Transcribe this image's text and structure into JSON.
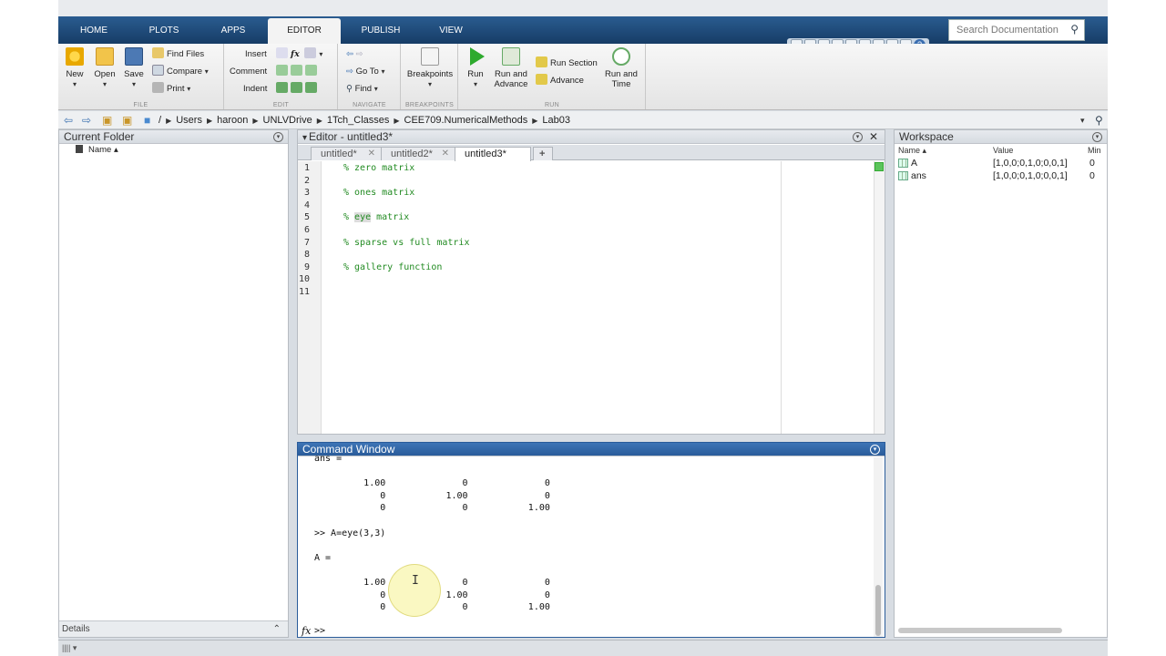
{
  "tabs": [
    "HOME",
    "PLOTS",
    "APPS",
    "EDITOR",
    "PUBLISH",
    "VIEW"
  ],
  "active_tab": "EDITOR",
  "search": {
    "placeholder": "Search Documentation"
  },
  "ribbon": {
    "file": {
      "new": "New",
      "open": "Open",
      "save": "Save",
      "find_files": "Find Files",
      "compare": "Compare",
      "print": "Print",
      "group": "FILE"
    },
    "edit": {
      "insert": "Insert",
      "comment": "Comment",
      "indent": "Indent",
      "fx": "fx",
      "group": "EDIT"
    },
    "navigate": {
      "goto": "Go To",
      "find": "Find",
      "group": "NAVIGATE"
    },
    "breakpoints": {
      "label": "Breakpoints",
      "group": "BREAKPOINTS"
    },
    "run": {
      "run": "Run",
      "run_advance_1": "Run and",
      "run_advance_2": "Advance",
      "run_section": "Run Section",
      "advance": "Advance",
      "run_time_1": "Run and",
      "run_time_2": "Time",
      "group": "RUN"
    }
  },
  "path": [
    "/",
    "Users",
    "haroon",
    "UNLVDrive",
    "1Tch_Classes",
    "CEE709.NumericalMethods",
    "Lab03"
  ],
  "current_folder": {
    "title": "Current Folder",
    "name_col": "Name ▴",
    "details": "Details"
  },
  "editor": {
    "title": "Editor - untitled3*",
    "tabs": [
      "untitled*",
      "untitled2*",
      "untitled3*"
    ],
    "add_tab": "+",
    "lines": [
      {
        "n": "1",
        "text": "% zero matrix"
      },
      {
        "n": "2",
        "text": ""
      },
      {
        "n": "3",
        "text": "% ones matrix"
      },
      {
        "n": "4",
        "text": ""
      },
      {
        "n": "5",
        "pre": "% ",
        "hl": "eye",
        "post": " matrix"
      },
      {
        "n": "6",
        "text": ""
      },
      {
        "n": "7",
        "text": "% sparse vs full matrix"
      },
      {
        "n": "8",
        "text": ""
      },
      {
        "n": "9",
        "text": "% gallery function"
      },
      {
        "n": "10",
        "text": ""
      },
      {
        "n": "11",
        "text": ""
      }
    ]
  },
  "command_window": {
    "title": "Command Window",
    "lines": [
      "ans =",
      "",
      "         1.00              0              0",
      "            0           1.00              0",
      "            0              0           1.00",
      "",
      ">> A=eye(3,3)",
      "",
      "A =",
      "",
      "         1.00              0              0",
      "            0           1.00              0",
      "            0              0           1.00"
    ],
    "prompt": ">>",
    "fx": "fx"
  },
  "workspace": {
    "title": "Workspace",
    "columns": [
      "Name ▴",
      "Value",
      "Min"
    ],
    "rows": [
      {
        "name": "A",
        "value": "[1,0,0;0,1,0;0,0,1]",
        "min": "0"
      },
      {
        "name": "ans",
        "value": "[1,0,0;0,1,0;0,0,1]",
        "min": "0"
      }
    ]
  },
  "colors": {
    "accent": "#1d4a7a",
    "comment": "#228b22",
    "run_green": "#2eaa2e"
  }
}
